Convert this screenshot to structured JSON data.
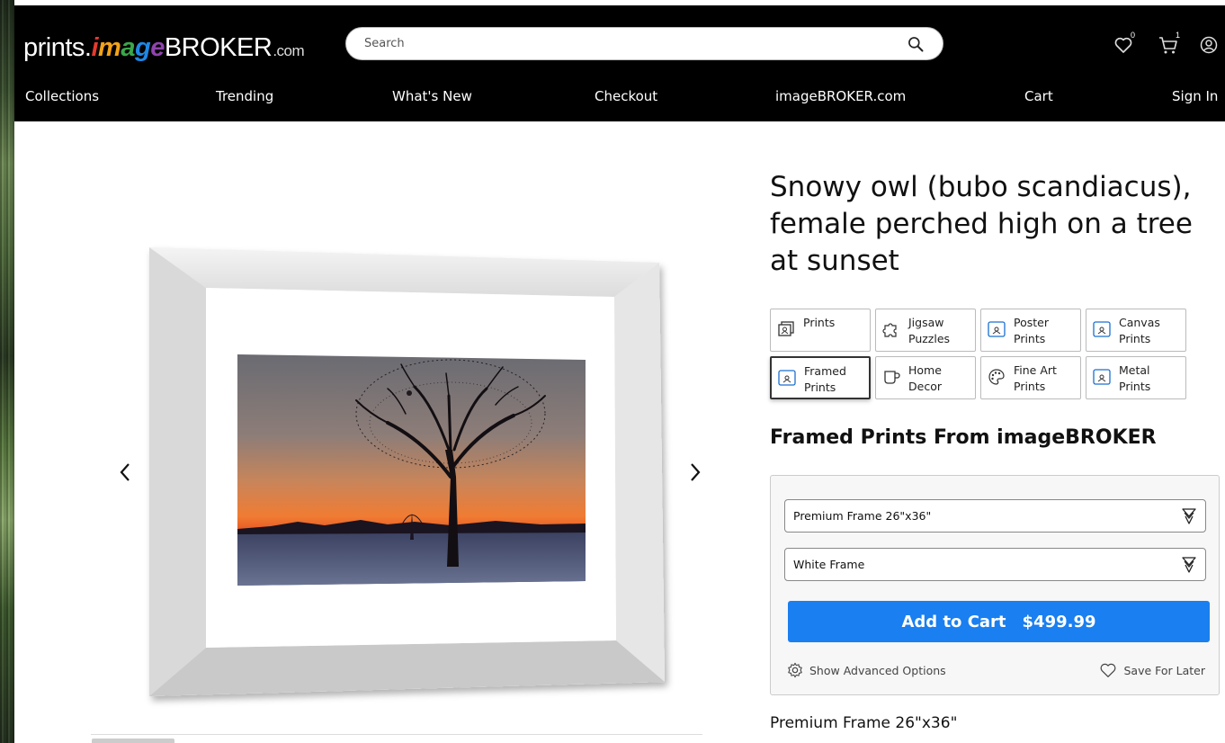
{
  "logo": {
    "part1": "prints.",
    "part2": "image",
    "part3": "BROKER",
    "part4": ".com"
  },
  "search": {
    "placeholder": "Search"
  },
  "header_icons": {
    "wishlist_count": "0",
    "cart_count": "1"
  },
  "nav": [
    "Collections",
    "Trending",
    "What's New",
    "Checkout",
    "imageBROKER.com",
    "Cart",
    "Sign In"
  ],
  "product": {
    "title": "Snowy owl (bubo scandiacus), female perched high on a tree at sunset"
  },
  "categories": [
    {
      "label": "Prints",
      "icon": "prints-icon"
    },
    {
      "label": "Jigsaw Puzzles",
      "icon": "puzzle-icon"
    },
    {
      "label": "Poster Prints",
      "icon": "poster-icon"
    },
    {
      "label": "Canvas Prints",
      "icon": "canvas-icon"
    },
    {
      "label": "Framed Prints",
      "icon": "framed-icon",
      "selected": true
    },
    {
      "label": "Home Decor",
      "icon": "mug-icon"
    },
    {
      "label": "Fine Art Prints",
      "icon": "palette-icon"
    },
    {
      "label": "Metal Prints",
      "icon": "metal-icon"
    }
  ],
  "section": {
    "heading": "Framed Prints From imageBROKER"
  },
  "options": {
    "size_select": "Premium Frame 26\"x36\"",
    "frame_select": "White Frame",
    "add_to_cart": "Add to Cart",
    "price": "$499.99",
    "advanced": "Show Advanced Options",
    "save_later": "Save For Later"
  },
  "footer_label": "Premium Frame 26\"x36\"",
  "colors": {
    "accent": "#1a7ff0",
    "header_bg": "#000000"
  }
}
